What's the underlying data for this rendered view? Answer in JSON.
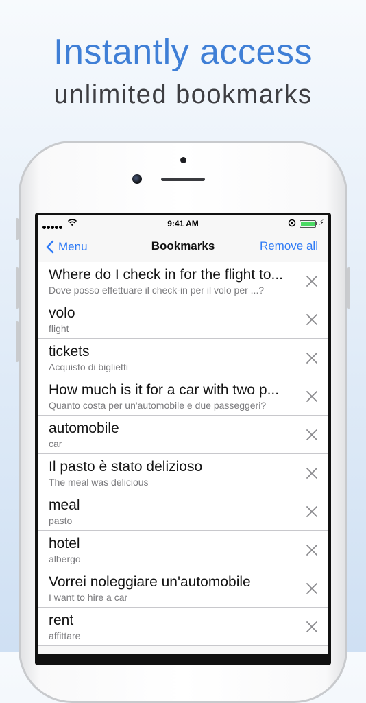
{
  "promo": {
    "headline": "Instantly access",
    "subline": "unlimited bookmarks"
  },
  "status_bar": {
    "time": "9:41 AM",
    "battery_color": "#4cd964"
  },
  "nav": {
    "back_label": "Menu",
    "title": "Bookmarks",
    "remove_all_label": "Remove all",
    "accent_color": "#2f7bf6"
  },
  "bookmarks": [
    {
      "title": "Where do I check in for the flight to...",
      "subtitle": "Dove posso effettuare il check-in per il volo per ...?"
    },
    {
      "title": "volo",
      "subtitle": "flight"
    },
    {
      "title": "tickets",
      "subtitle": "Acquisto di biglietti"
    },
    {
      "title": "How much is it for a car with two p...",
      "subtitle": "Quanto costa per un'automobile e due passeggeri?"
    },
    {
      "title": "automobile",
      "subtitle": "car"
    },
    {
      "title": "Il pasto è stato delizioso",
      "subtitle": "The meal was delicious"
    },
    {
      "title": "meal",
      "subtitle": "pasto"
    },
    {
      "title": "hotel",
      "subtitle": "albergo"
    },
    {
      "title": "Vorrei noleggiare un'automobile",
      "subtitle": "I want to hire a car"
    },
    {
      "title": "rent",
      "subtitle": "affittare"
    }
  ]
}
